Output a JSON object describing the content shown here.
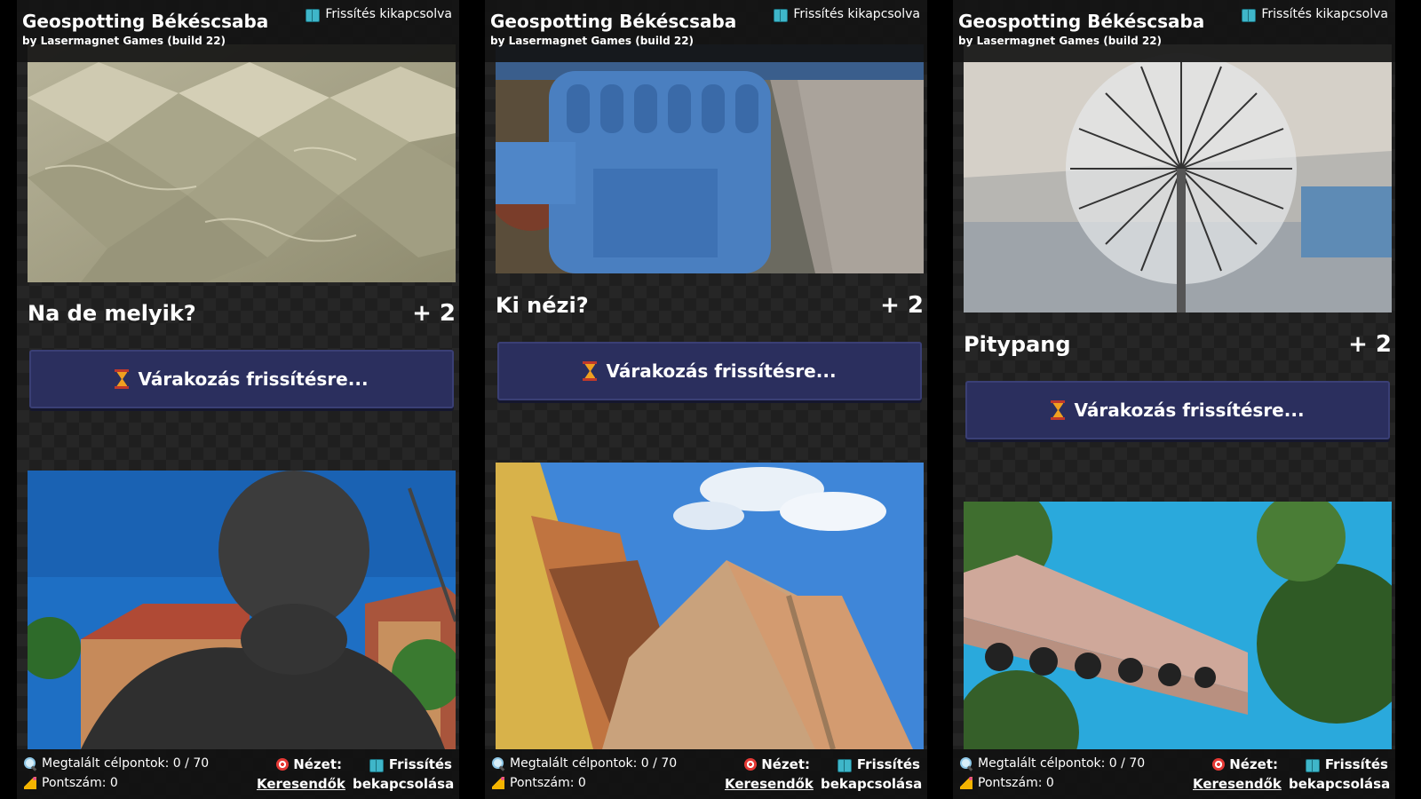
{
  "app": {
    "title": "Geospotting Békéscsaba",
    "subtitle": "by Lasermagnet Games (build 22)",
    "refresh_status": "Frissítés kikapcsolva"
  },
  "panels": [
    {
      "card": {
        "title": "Na de melyik?",
        "points": "+ 2",
        "button": "Várakozás frissítésre..."
      },
      "image1": "tiled-fountain-water-photo",
      "image2": "bronze-bust-statue-photo"
    },
    {
      "card": {
        "title": "Ki nézi?",
        "points": "+ 2",
        "button": "Várakozás frissítésre..."
      },
      "image1": "blue-water-pump-photo",
      "image2": "apartment-building-sky-photo"
    },
    {
      "card": {
        "title": "Pitypang",
        "points": "+ 2",
        "button": "Várakozás frissítésre..."
      },
      "image1": "dandelion-fountain-photo",
      "image2": "bell-tower-photo"
    }
  ],
  "footer": {
    "found_label": "Megtalált célpontok: 0 / 70",
    "score_label": "Pontszám: 0",
    "view_label": "Nézet:",
    "view_value": "Keresendők",
    "refresh_line1": "Frissítés",
    "refresh_line2": "bekapcsolása"
  },
  "icons": [
    "book-icon",
    "hourglass-icon",
    "magnifier-icon",
    "party-icon",
    "target-icon"
  ],
  "colors": {
    "button_bg": "#2b2f5e",
    "panel_bg": "#1f1f1f",
    "accent_teal": "#3fb6c9"
  }
}
